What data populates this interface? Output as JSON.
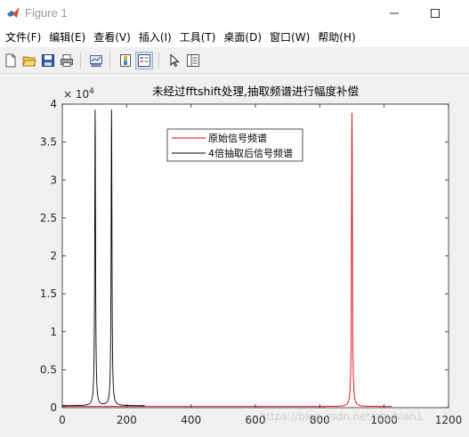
{
  "window": {
    "title": "Figure 1",
    "minimize_icon": "minimize-icon",
    "maximize_icon": "maximize-icon"
  },
  "menu": {
    "items": [
      "文件(F)",
      "编辑(E)",
      "查看(V)",
      "插入(I)",
      "工具(T)",
      "桌面(D)",
      "窗口(W)",
      "帮助(H)"
    ]
  },
  "toolbar": {
    "icons": [
      "new-figure-icon",
      "open-file-icon",
      "save-icon",
      "print-icon",
      "link-plot-icon",
      "colorbar-icon",
      "legend-icon",
      "pointer-icon",
      "property-inspector-icon"
    ]
  },
  "watermark": "https://blog.csdn.net/zhubian1",
  "chart_data": {
    "type": "line",
    "title": "未经过fftshift处理,抽取频谱进行幅度补偿",
    "xlabel": "",
    "ylabel": "",
    "xlim": [
      0,
      1200
    ],
    "ylim": [
      0,
      40000
    ],
    "x_ticks": [
      "0",
      "200",
      "400",
      "600",
      "800",
      "1000",
      "1200"
    ],
    "y_ticks": [
      "0",
      "0.5",
      "1",
      "1.5",
      "2",
      "2.5",
      "3",
      "3.5",
      "4"
    ],
    "y_exponent": "× 10",
    "y_exponent_power": "4",
    "grid": false,
    "legend_position": "top-center",
    "series": [
      {
        "name": "原始信号频谱",
        "color": "#e00000",
        "peak_x": 900,
        "peak_y": 38700,
        "x_range": [
          0,
          1024
        ],
        "baseline": 300
      },
      {
        "name": "4倍抽取后信号频谱",
        "color": "#000000",
        "peaks": [
          {
            "x": 102,
            "y": 39000
          },
          {
            "x": 153,
            "y": 39000
          }
        ],
        "x_range": [
          0,
          256
        ],
        "baseline": 500
      }
    ]
  }
}
